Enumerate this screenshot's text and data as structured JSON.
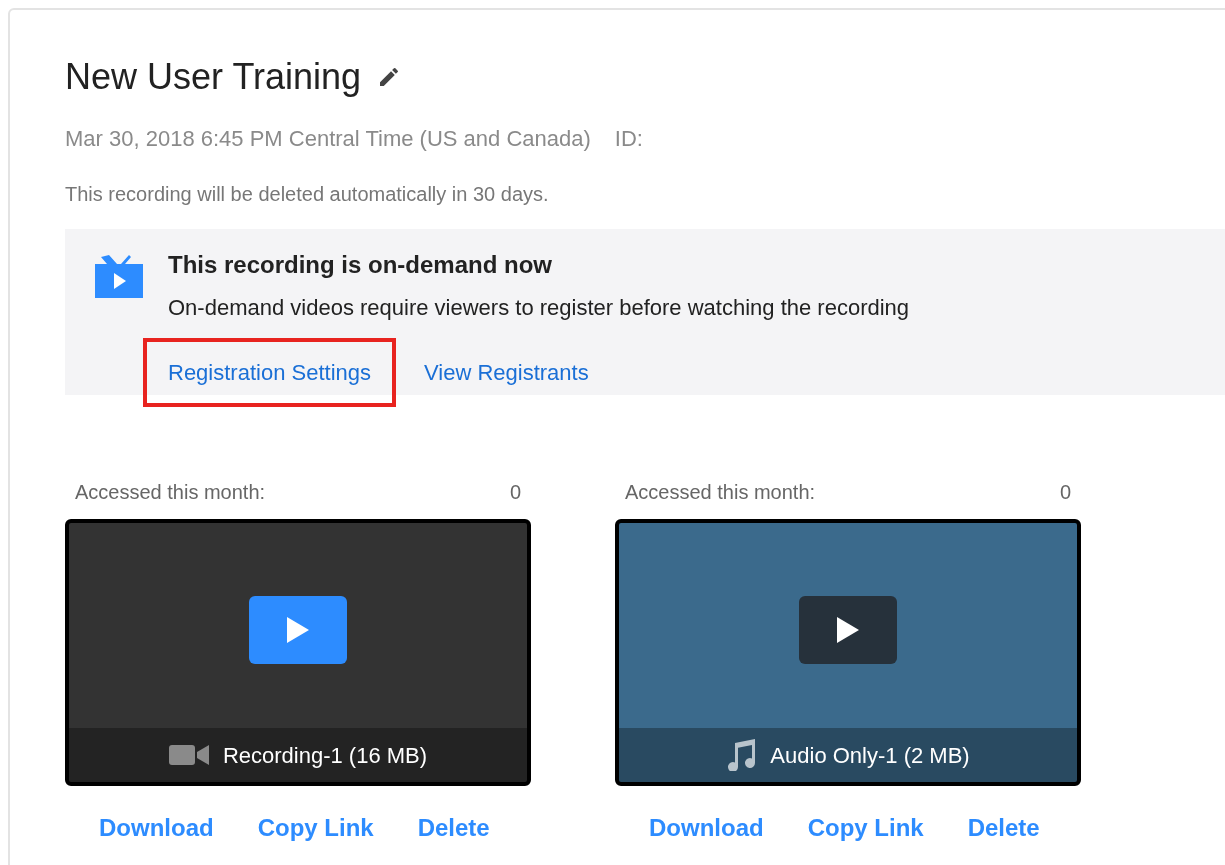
{
  "meeting": {
    "title": "New User Training",
    "date": "Mar 30, 2018 6:45 PM Central Time (US and Canada)",
    "id_label": "ID:",
    "notice": "This recording will be deleted automatically in 30 days."
  },
  "banner": {
    "title": "This recording is on-demand now",
    "text": "On-demand videos require viewers to register before watching the recording",
    "links": [
      {
        "label": "Registration Settings",
        "highlighted": true
      },
      {
        "label": "View Registrants",
        "highlighted": false
      }
    ]
  },
  "recordings": [
    {
      "kind": "video",
      "accessed_label": "Accessed this month:",
      "count": "0",
      "name": "Recording-1 (16 MB)",
      "actions": [
        "Download",
        "Copy Link",
        "Delete"
      ]
    },
    {
      "kind": "audio",
      "accessed_label": "Accessed this month:",
      "count": "0",
      "name": "Audio Only-1 (2 MB)",
      "actions": [
        "Download",
        "Copy Link",
        "Delete"
      ]
    }
  ]
}
